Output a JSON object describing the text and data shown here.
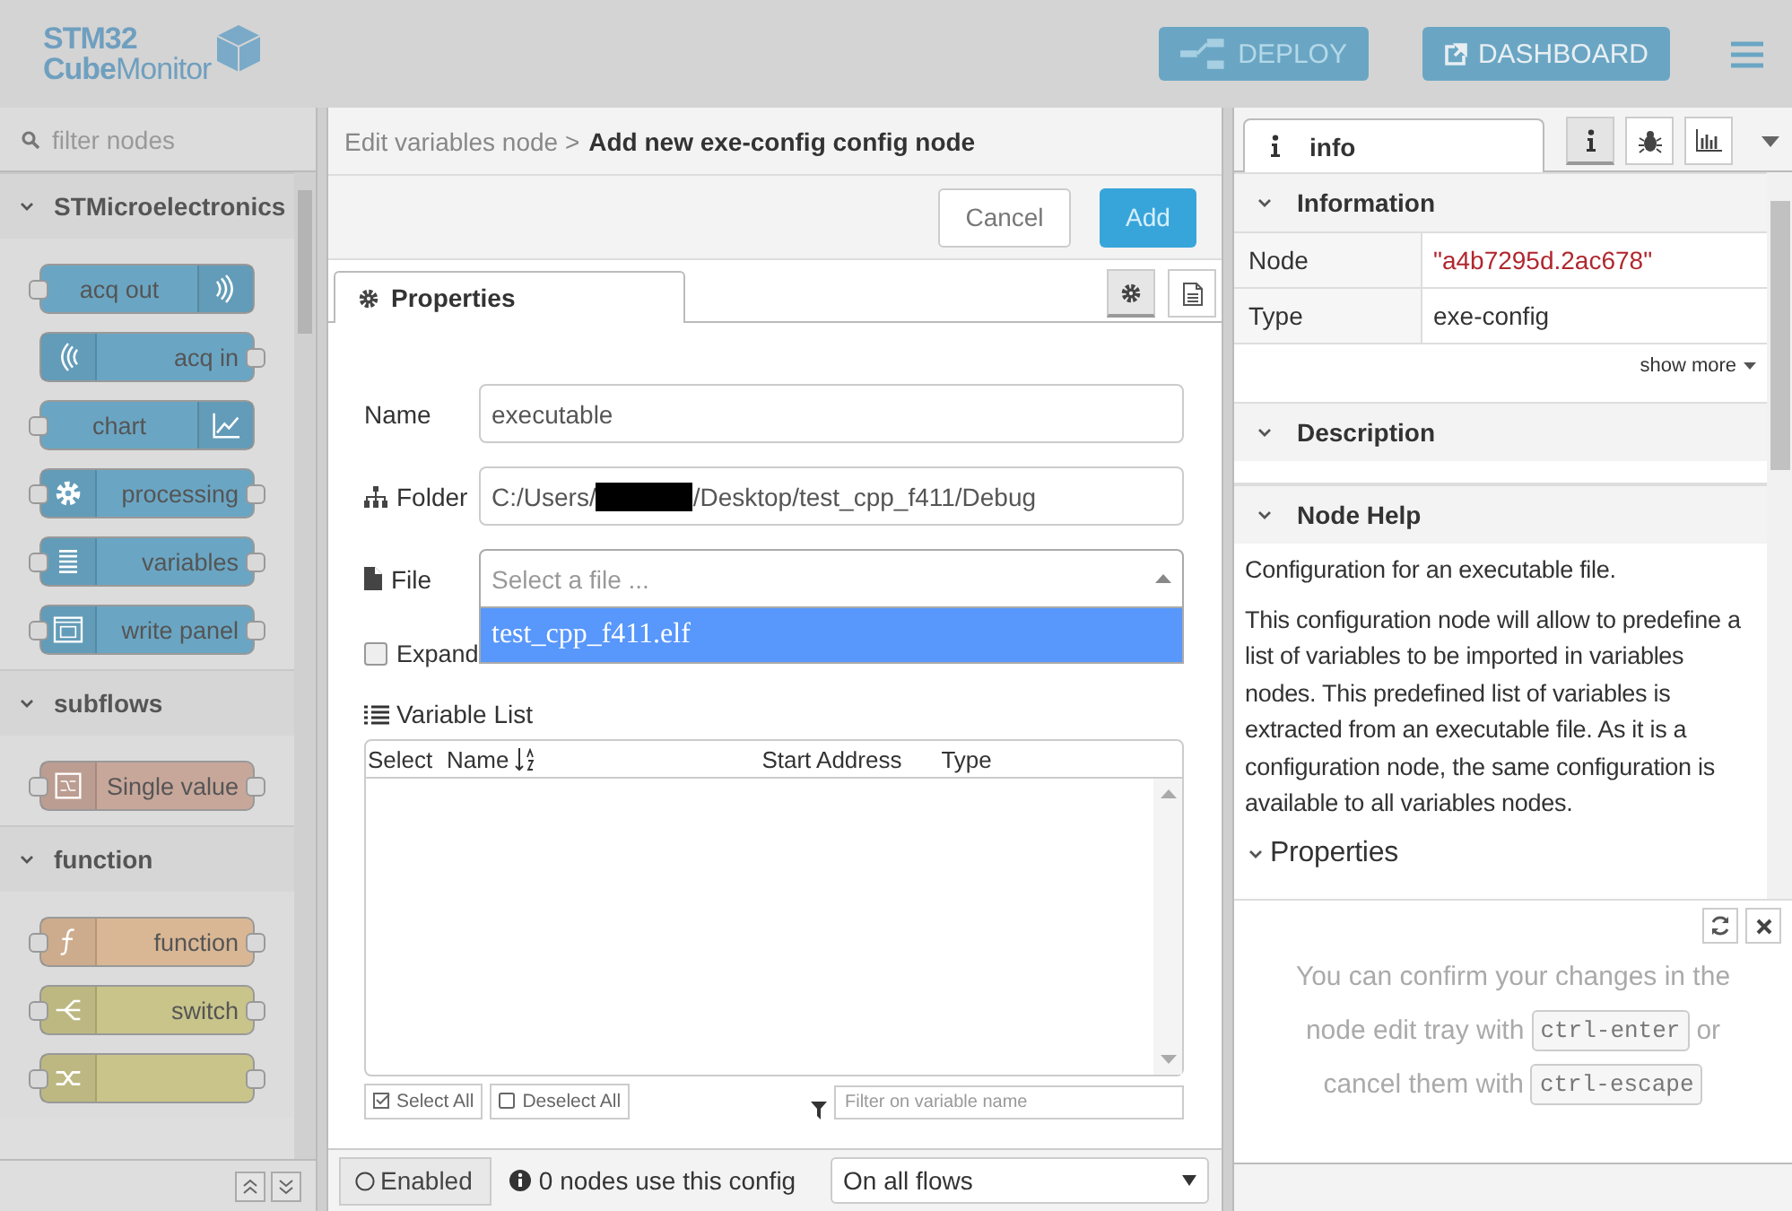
{
  "header": {
    "logo": {
      "line1": "STM32",
      "line2": "**Cube**Monitor"
    },
    "buttons": [
      {
        "label": "DEPLOY",
        "disabled": true
      },
      {
        "label": "DASHBOARD",
        "disabled": false
      }
    ]
  },
  "palette": {
    "search": {
      "placeholder": "filter nodes"
    },
    "categories": [
      {
        "name": "STMicroelectronics",
        "expanded": true,
        "nodes": [
          {
            "label": "acq out",
            "color": "#6aa6c4",
            "kind": "acq-out",
            "input": true,
            "output": false
          },
          {
            "label": "acq in",
            "color": "#6aa6c4",
            "kind": "acq-in",
            "input": false,
            "output": true
          },
          {
            "label": "chart",
            "color": "#6aa6c4",
            "kind": "chart",
            "input": true,
            "output": false
          },
          {
            "label": "processing",
            "color": "#6aa6c4",
            "kind": "processing",
            "input": true,
            "output": true
          },
          {
            "label": "variables",
            "color": "#6aa6c4",
            "kind": "variables",
            "input": true,
            "output": true
          },
          {
            "label": "write panel",
            "color": "#6aa6c4",
            "kind": "panel",
            "input": true,
            "output": true
          }
        ]
      },
      {
        "name": "subflows",
        "expanded": true,
        "nodes": [
          {
            "label": "Single value",
            "color": "#c8a79b",
            "kind": "subflow",
            "input": true,
            "output": true
          }
        ]
      },
      {
        "name": "function",
        "expanded": true,
        "nodes": [
          {
            "label": "function",
            "color": "#d9b795",
            "kind": "function",
            "input": true,
            "output": true
          },
          {
            "label": "switch",
            "color": "#c9c48a",
            "kind": "switch",
            "input": true,
            "output": true
          },
          {
            "color": "#c9c48a",
            "kind": "change",
            "input": true,
            "output": true
          }
        ]
      }
    ]
  },
  "tray": {
    "breadcrumb": {
      "parent": "Edit variables node >",
      "current": "Add new exe-config config node"
    },
    "buttons": [
      {
        "label": "Cancel",
        "kind": "secondary"
      },
      {
        "label": "Add",
        "kind": "primary"
      }
    ],
    "tabs": [
      {
        "label": "Properties",
        "selected": true
      }
    ],
    "tab_icons": [
      {
        "selected": true
      },
      {
        "selected": false
      }
    ],
    "fields": [
      {
        "label": "Name",
        "kind": "text",
        "value": "executable"
      },
      {
        "label": "Folder",
        "kind": "path",
        "value_parts": [
          "C:/Users/",
          "/Desktop/test_cpp_f411/Debug"
        ]
      },
      {
        "label": "File",
        "kind": "select",
        "placeholder": "Select a file ...",
        "options": [
          {
            "label": "test_cpp_f411.elf",
            "selected": true
          }
        ]
      }
    ],
    "expand": {
      "label": "Expand",
      "checked": false
    },
    "variable_list": {
      "title": "Variable List",
      "columns": [
        "Select",
        "Name",
        "Start Address",
        "Type"
      ],
      "buttons": [
        "Select All",
        "Deselect All"
      ],
      "filter": {
        "placeholder": "Filter on variable name"
      }
    },
    "footer": {
      "toggle": {
        "label": "Enabled",
        "on": false
      },
      "usage": "0 nodes use this config",
      "scope": "On all flows"
    }
  },
  "sidebar": {
    "tabs": [
      {
        "label": "info",
        "selected": true
      }
    ],
    "tab_buttons": [
      {
        "selected": true
      },
      {
        "selected": false
      },
      {
        "selected": false
      }
    ],
    "sections": [
      {
        "title": "Information",
        "expanded": true,
        "rows": [
          {
            "key": "Node",
            "value": "\"a4b7295d.2ac678\"",
            "kind": "id"
          },
          {
            "key": "Type",
            "value": "exe-config",
            "kind": "plain"
          }
        ],
        "more": "show more"
      },
      {
        "title": "Description",
        "expanded": true
      },
      {
        "title": "Node Help",
        "expanded": true,
        "paragraphs": [
          "Configuration for an executable file.",
          "This configuration node will allow to predefine a list of variables to be imported in variables nodes. This predefined list of variables is extracted from an executable file. As it is a configuration node, the same configuration is available to all variables nodes."
        ],
        "subheading": "Properties"
      }
    ],
    "tip_lines": [
      [
        {
          "kind": "text",
          "text": "You can confirm your changes in the"
        }
      ],
      [
        {
          "kind": "text",
          "text": "node edit tray with"
        },
        {
          "kind": "key",
          "text": "ctrl-enter"
        },
        {
          "kind": "text",
          "text": "or"
        }
      ],
      [
        {
          "kind": "text",
          "text": "cancel them with"
        },
        {
          "kind": "key",
          "text": "ctrl-escape"
        }
      ]
    ]
  }
}
